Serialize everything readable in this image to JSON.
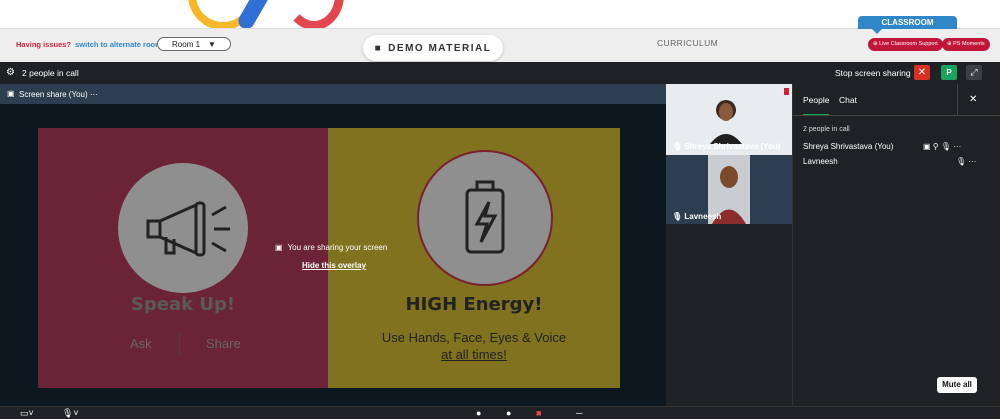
{
  "header": {
    "issues_text": "Having issues?",
    "alt_room_text": "switch to alternate room",
    "room_label": "Room 1",
    "demo_material": "DEMO MATERIAL",
    "curriculum": "CURRICULUM",
    "classroom": "CLASSROOM",
    "live_support": "Live Classroom Support",
    "ps_moments": "PS Moments"
  },
  "callbar": {
    "people_in_call": "2 people in call",
    "stop_sharing": "Stop screen sharing",
    "presence_badge": "P"
  },
  "screenshare": {
    "tab_label": "Screen share (You)",
    "overlay_text": "You are sharing your screen",
    "hide_overlay": "Hide this overlay"
  },
  "slide": {
    "left_title": "Speak Up!",
    "left_ask": "Ask",
    "left_share": "Share",
    "right_title": "HIGH Energy!",
    "right_line1": "Use Hands, Face, Eyes & Voice",
    "right_line2": "at all times!"
  },
  "tiles": [
    {
      "name": "Shreya Shrivastava (You)"
    },
    {
      "name": "Lavneesh"
    }
  ],
  "panel": {
    "tab_people": "People",
    "tab_chat": "Chat",
    "count": "2 people in call",
    "people": [
      {
        "name": "Shreya Shrivastava (You)"
      },
      {
        "name": "Lavneesh"
      }
    ],
    "mute_all": "Mute all"
  },
  "colors": {
    "accent_green": "#1aa260",
    "danger_red": "#d93025",
    "brand_blue": "#2f86c9"
  }
}
